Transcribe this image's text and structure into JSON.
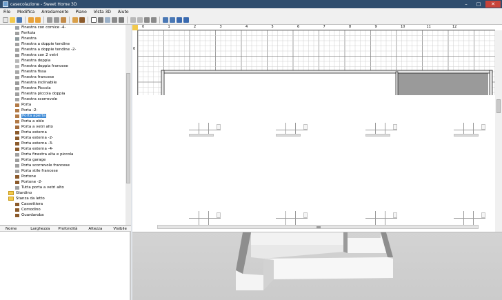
{
  "window": {
    "title": "casecolazione - Sweet Home 3D"
  },
  "menu": [
    "File",
    "Modifica",
    "Arredamento",
    "Piano",
    "Vista 3D",
    "Aiuto"
  ],
  "tree": {
    "items": [
      {
        "label": "Finestra con cornice -4-",
        "color": "#9aa0a6"
      },
      {
        "label": "Feritoia",
        "color": "#a0a0a0"
      },
      {
        "label": "Finestra",
        "color": "#8f9a9e"
      },
      {
        "label": "Finestra a doppie tendine",
        "color": "#a2a2a2"
      },
      {
        "label": "Finestra a doppie tendine -2-",
        "color": "#a2a2a2"
      },
      {
        "label": "Finestra con 2 vetri",
        "color": "#9b9b9b"
      },
      {
        "label": "Finestra doppia",
        "color": "#b7b7b7"
      },
      {
        "label": "Finestra doppia francese",
        "color": "#b7b7b7"
      },
      {
        "label": "Finestra fissa",
        "color": "#a8a8a8"
      },
      {
        "label": "Finestra francese",
        "color": "#a0a0a0"
      },
      {
        "label": "Finestra inclinabile",
        "color": "#9a9a9a"
      },
      {
        "label": "Finestra Piccola",
        "color": "#a0a0a0"
      },
      {
        "label": "Finestra piccola doppia",
        "color": "#a0a0a0"
      },
      {
        "label": "Finestra scorrevole",
        "color": "#a3a3a3"
      },
      {
        "label": "Porta",
        "color": "#b27a47"
      },
      {
        "label": "Porta -2-",
        "color": "#b27a47"
      },
      {
        "label": "Porta aperta",
        "color": "#b27a47",
        "selected": true
      },
      {
        "label": "Porta a oblo",
        "color": "#b27a47"
      },
      {
        "label": "Porta a vetri alto",
        "color": "#a46c3c"
      },
      {
        "label": "Porta esterna",
        "color": "#8b5a2b"
      },
      {
        "label": "Porta esterna -2-",
        "color": "#8b5a2b"
      },
      {
        "label": "Porta esterna -3-",
        "color": "#8b5a2b"
      },
      {
        "label": "Porta esterna -4-",
        "color": "#8b5a2b"
      },
      {
        "label": "Porta finestra alta e piccola",
        "color": "#a0a0a0"
      },
      {
        "label": "Porta garage",
        "color": "#9e9e9e"
      },
      {
        "label": "Porta scorrevole francese",
        "color": "#a0a0a0"
      },
      {
        "label": "Porta stile francese",
        "color": "#a0a0a0"
      },
      {
        "label": "Portone",
        "color": "#8b5a2b"
      },
      {
        "label": "Portone -2-",
        "color": "#8b5a2b"
      },
      {
        "label": "Tutta porta a vetri alto",
        "color": "#a0a0a0"
      }
    ],
    "categories": [
      "Giardino",
      "Stanza da letto"
    ],
    "sub_items": [
      {
        "label": "Cassettiera",
        "color": "#8b5a2b"
      },
      {
        "label": "Comodino",
        "color": "#8b5a2b"
      },
      {
        "label": "Guardaroba",
        "color": "#8b5a2b"
      }
    ]
  },
  "furniture_table": {
    "columns": [
      "Nome",
      "Larghezza",
      "Profondità",
      "Altezza",
      "Visibile"
    ]
  },
  "ruler": {
    "top_labels": [
      "0",
      "1",
      "2",
      "3",
      "4",
      "5",
      "6",
      "7",
      "8",
      "9",
      "10",
      "11",
      "12"
    ],
    "left_label": "0"
  }
}
